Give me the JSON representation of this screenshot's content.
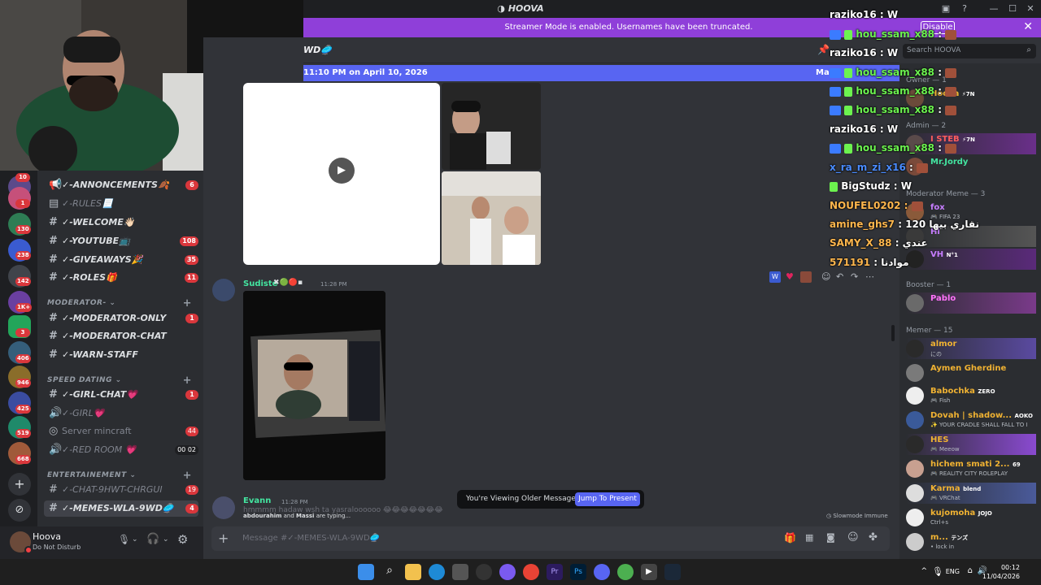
{
  "app": {
    "title": "HOOVA"
  },
  "streamer_banner": {
    "text": "Streamer Mode is enabled. Usernames have been truncated.",
    "button": "Disable"
  },
  "channel": {
    "name": "WD🥏",
    "pinned_time": "11:10 PM on April 10, 2026",
    "pinned_right": "Mar"
  },
  "search": {
    "placeholder": "Search HOOVA"
  },
  "server_badges": [
    "10",
    "1",
    "130",
    "238",
    "142",
    "1K+",
    "3",
    "406",
    "946",
    "425",
    "519",
    "668"
  ],
  "channels": [
    {
      "label": "✓-ANNONCEMENTS🍂",
      "badge": "6",
      "type": "announce"
    },
    {
      "label": "✓-RULES📃",
      "badge": "",
      "type": "rules"
    },
    {
      "label": "✓-WELCOME👋🏻",
      "badge": "",
      "type": "text"
    },
    {
      "label": "✓-YOUTUBE📺",
      "badge": "108",
      "type": "text"
    },
    {
      "label": "✓-GIVEAWAYS🎉",
      "badge": "35",
      "type": "text"
    },
    {
      "label": "✓-ROLES🎁",
      "badge": "11",
      "type": "text"
    }
  ],
  "cat_moderator": "MODERATOR- ⌄",
  "mod_channels": [
    {
      "label": "✓-MODERATOR-ONLY",
      "badge": "1"
    },
    {
      "label": "✓-MODERATOR-CHAT",
      "badge": ""
    },
    {
      "label": "✓-WARN-STAFF",
      "badge": ""
    }
  ],
  "cat_speed": "SPEED DATING ⌄",
  "speed_channels": [
    {
      "label": "✓-GIRL-CHAT💗",
      "badge": "1"
    },
    {
      "label": "✓-GIRL💗",
      "badge": ""
    },
    {
      "label": "Server mincraft",
      "badge": "44"
    },
    {
      "label": "✓-RED ROOM 💗",
      "badge": "00 02"
    }
  ],
  "cat_entertainment": "ENTERTAINEMENT ⌄",
  "ent_channels": [
    {
      "label": "✓-CHAT-9HWT-CHRGUI",
      "badge": "19"
    },
    {
      "label": "✓-MEMES-WLA-9WD🥏",
      "badge": "4"
    }
  ],
  "user": {
    "name": "Hoova",
    "status": "Do Not Disturb"
  },
  "messages": {
    "m1": {
      "author": "Sudiste",
      "time": "11:28 PM"
    },
    "m2": {
      "author": "Evann",
      "time": "11:28 PM",
      "text": "hmmmm hadaw wsh ta yasraloooooo 😂😂😂😂😂😂😂"
    }
  },
  "older": {
    "text": "You're Viewing Older Messages",
    "button": "Jump To Present"
  },
  "typing": {
    "names": "abdourahim",
    "and": "and",
    "names2": "Massi",
    "suffix": "are typing..."
  },
  "slowmode": "Slowmode Immune",
  "composer": {
    "placeholder": "Message #✓-MEMES-WLA-9WD🥏"
  },
  "roles": {
    "owner": "Owner — 1",
    "admin": "Admin — 2",
    "modmeme": "Moderator Meme — 3",
    "booster": "Booster — 1",
    "memer": "Memer — 15"
  },
  "members": [
    {
      "name": "Hoova",
      "sub": "",
      "color": "#f0b232",
      "tag": "⚡7N"
    },
    {
      "name": "I STEB",
      "sub": "",
      "color": "#ff5c5c",
      "tag": "⚡7N"
    },
    {
      "name": "Mr.Jordy",
      "sub": "",
      "color": "#43e5a0",
      "tag": ""
    },
    {
      "name": "fox",
      "sub": "🎮 FIFA 23",
      "color": "#c77dff",
      "tag": ""
    },
    {
      "name": "Hi",
      "sub": "",
      "color": "#c77dff",
      "tag": ""
    },
    {
      "name": "VH",
      "sub": "",
      "color": "#c77dff",
      "tag": "N°1"
    },
    {
      "name": "Pablo",
      "sub": "",
      "color": "#ff73fa",
      "tag": ""
    },
    {
      "name": "almor",
      "sub": "にの",
      "color": "#f0b232",
      "tag": ""
    },
    {
      "name": "Aymen Gherdine",
      "sub": "",
      "color": "#f0b232",
      "tag": ""
    },
    {
      "name": "Babochka",
      "sub": "🎮 Fish",
      "color": "#f0b232",
      "tag": "ZERO"
    },
    {
      "name": "Dovah | shadow...",
      "sub": "✨ YOUR CRADLE SHALL FALL TO I",
      "color": "#f0b232",
      "tag": "AOKO"
    },
    {
      "name": "HES",
      "sub": "🎮 Meeow",
      "color": "#f0b232",
      "tag": ""
    },
    {
      "name": "hichem smati 2...",
      "sub": "🎮 REALITY CITY ROLEPLAY",
      "color": "#f0b232",
      "tag": "69"
    },
    {
      "name": "Karma",
      "sub": "🎮 VRChat",
      "color": "#f0b232",
      "tag": "blend"
    },
    {
      "name": "kujomoha",
      "sub": "Ctrl+s",
      "color": "#f0b232",
      "tag": "JOJO"
    },
    {
      "name": "m...",
      "sub": "• lock in",
      "color": "#f0b232",
      "tag": "テンズ"
    }
  ],
  "overlay": [
    {
      "user": "raziko16",
      "msg": "W",
      "style": "w"
    },
    {
      "user": "hou_ssam_x88",
      "msg": "",
      "style": "g"
    },
    {
      "user": "raziko16",
      "msg": "W",
      "style": "w"
    },
    {
      "user": "hou_ssam_x88",
      "msg": "",
      "style": "g"
    },
    {
      "user": "hou_ssam_x88",
      "msg": "",
      "style": "g"
    },
    {
      "user": "hou_ssam_x88",
      "msg": "",
      "style": "g"
    },
    {
      "user": "raziko16",
      "msg": "W",
      "style": "w"
    },
    {
      "user": "hou_ssam_x88",
      "msg": "",
      "style": "g"
    },
    {
      "user": "x_ra_m_zi_x16",
      "msg": "",
      "style": "b"
    },
    {
      "user": "BigStudz",
      "msg": "W",
      "style": "g"
    },
    {
      "user": "NOUFEL0202",
      "msg": "",
      "style": "o"
    },
    {
      "user": "amine_ghs7",
      "msg": "120 نقاري بيها",
      "style": "o"
    },
    {
      "user": "SAMY_X_88",
      "msg": "عندي",
      "style": "o"
    },
    {
      "user": "571191",
      "msg": "موادنا",
      "style": "o"
    }
  ],
  "taskbar": {
    "lang": "ENG",
    "time": "00:12",
    "date": "11/04/2026"
  }
}
